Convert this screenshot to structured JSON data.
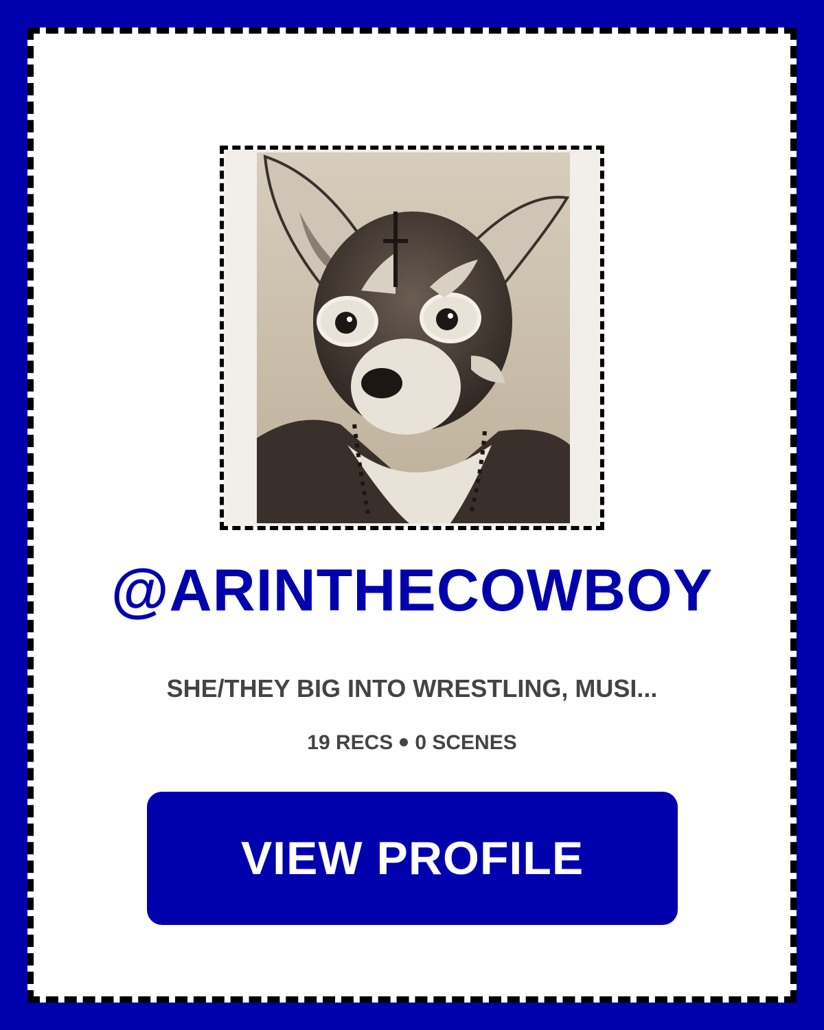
{
  "colors": {
    "brand": "#0000AD",
    "card_background": "#FFFFFF",
    "frame": "#000000",
    "muted_text": "#444444",
    "button_text": "#FFFFFF"
  },
  "profile": {
    "avatar_alt": "masked-chihuahua-wrestler-portrait",
    "username": "@ARINTHECOWBOY",
    "bio": "SHE/THEY BIG INTO WRESTLING, MUSI...",
    "recs": "19 RECS",
    "scenes": "0 SCENES"
  },
  "actions": {
    "view_profile_label": "VIEW PROFILE"
  }
}
